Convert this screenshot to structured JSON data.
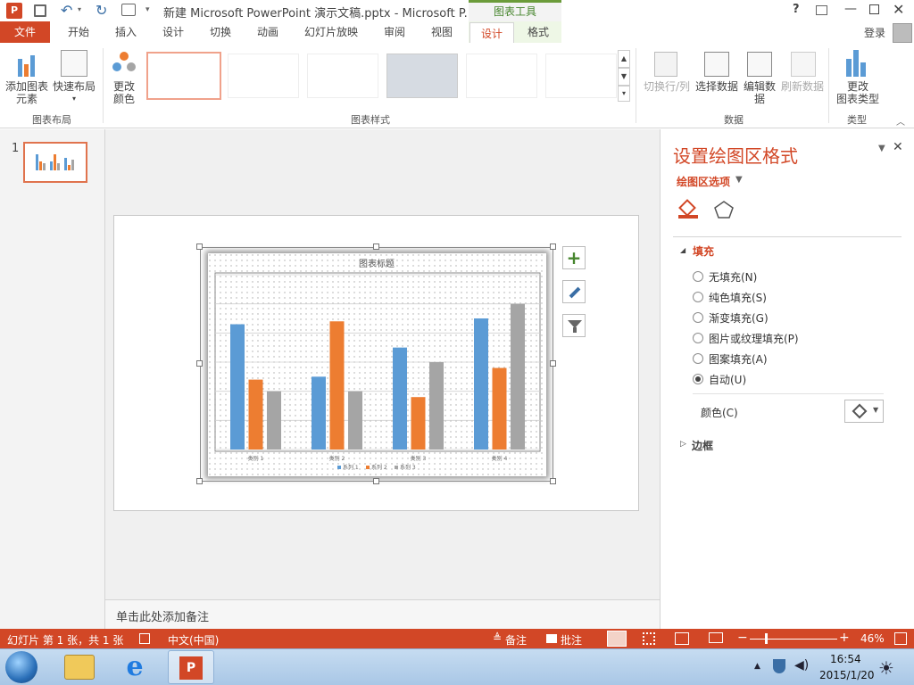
{
  "titlebar": {
    "title": "新建 Microsoft PowerPoint 演示文稿.pptx - Microsoft P...",
    "context_tools": "图表工具",
    "help": "?",
    "login": "登录"
  },
  "tabs": [
    "文件",
    "开始",
    "插入",
    "设计",
    "切换",
    "动画",
    "幻灯片放映",
    "审阅",
    "视图",
    "设计",
    "格式"
  ],
  "ribbon": {
    "add_element": "添加图表\n元素",
    "quick_layout": "快速布局",
    "group_layout": "图表布局",
    "change_colors": "更改\n颜色",
    "group_styles": "图表样式",
    "switch_rowcol": "切换行/列",
    "select_data": "选择数据",
    "edit_data": "编辑数\n据",
    "refresh_data": "刷新数据",
    "group_data": "数据",
    "change_type": "更改\n图表类型",
    "group_type": "类型"
  },
  "slides": {
    "number": "1"
  },
  "chart_data": {
    "type": "bar",
    "title": "图表标题",
    "categories": [
      "类别 1",
      "类别 2",
      "类别 3",
      "类别 4"
    ],
    "series": [
      {
        "name": "系列 1",
        "values": [
          4.3,
          2.5,
          3.5,
          4.5
        ],
        "color": "#5b9bd5"
      },
      {
        "name": "系列 2",
        "values": [
          2.4,
          4.4,
          1.8,
          2.8
        ],
        "color": "#ed7d31"
      },
      {
        "name": "系列 3",
        "values": [
          2,
          2,
          3,
          5
        ],
        "color": "#a5a5a5"
      }
    ],
    "ylim": [
      0,
      6
    ],
    "grid": true,
    "legend": "bottom"
  },
  "notes": {
    "placeholder": "单击此处添加备注"
  },
  "pane": {
    "title": "设置绘图区格式",
    "subtitle": "绘图区选项",
    "fill_section": "填充",
    "options": [
      "无填充(N)",
      "纯色填充(S)",
      "渐变填充(G)",
      "图片或纹理填充(P)",
      "图案填充(A)",
      "自动(U)"
    ],
    "selected_option": 5,
    "color_label": "颜色(C)",
    "border_section": "边框"
  },
  "status": {
    "slide_info": "幻灯片 第 1 张，共 1 张",
    "language": "中文(中国)",
    "notes": "备注",
    "comments": "批注",
    "zoom": "46%"
  },
  "taskbar": {
    "time": "16:54",
    "date": "2015/1/20"
  },
  "colors": {
    "accent": "#d24726",
    "context": "#47862e"
  }
}
